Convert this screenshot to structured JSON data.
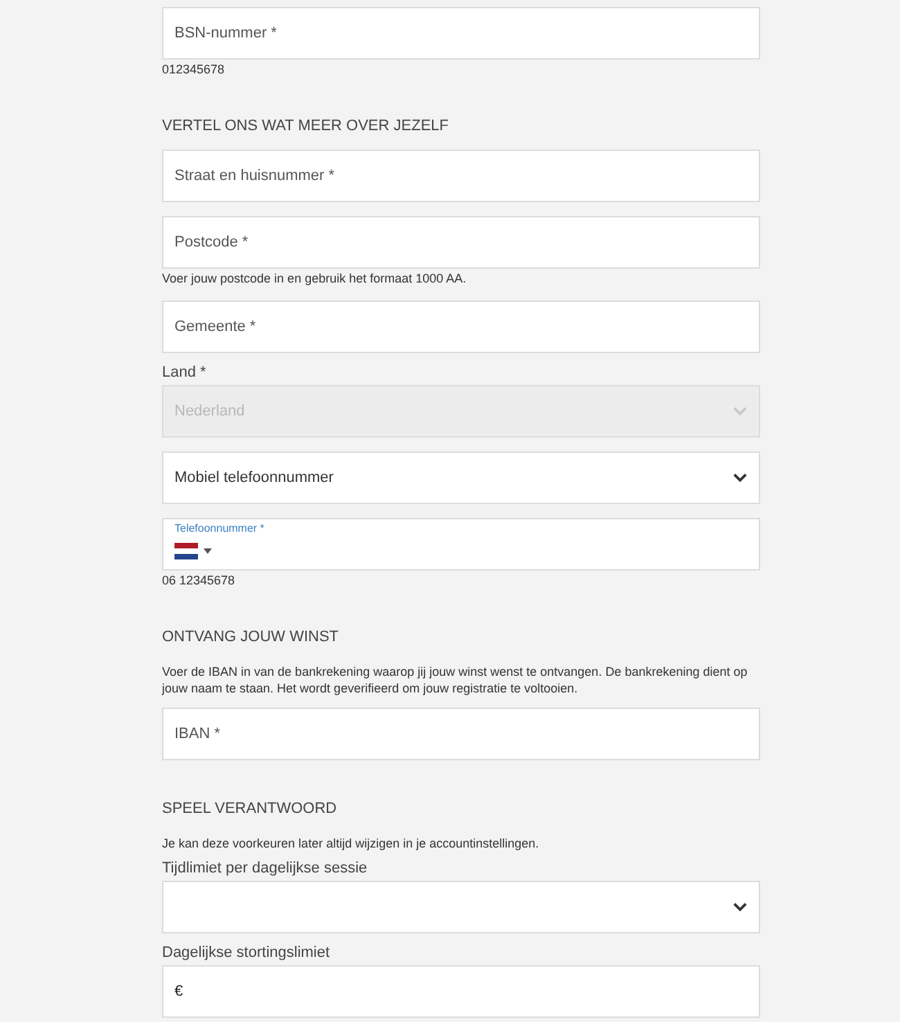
{
  "fields": [
    {
      "kind": "input",
      "placeholder": "BSN-nummer *"
    },
    {
      "kind": "hint",
      "text": "012345678"
    },
    {
      "kind": "heading",
      "text": "VERTEL ONS WAT MEER OVER JEZELF"
    },
    {
      "kind": "input",
      "placeholder": "Straat en huisnummer *"
    },
    {
      "kind": "input",
      "placeholder": "Postcode *"
    },
    {
      "kind": "hint",
      "text": "Voer jouw postcode in en gebruik het formaat 1000 AA."
    },
    {
      "kind": "input",
      "placeholder": "Gemeente *"
    },
    {
      "kind": "label",
      "text": "Land *"
    },
    {
      "kind": "select",
      "value": "Nederland",
      "disabled": true
    },
    {
      "kind": "select",
      "value": "Mobiel telefoonnummer",
      "disabled": false
    },
    {
      "kind": "phone",
      "label": "Telefoonnummer *"
    },
    {
      "kind": "hint",
      "text": "06 12345678"
    },
    {
      "kind": "heading",
      "text": "ONTVANG JOUW WINST"
    },
    {
      "kind": "paragraph",
      "text": "Voer de IBAN in van de bankrekening waarop jij jouw winst wenst te ontvangen. De bankrekening dient op jouw naam te staan. Het wordt geverifieerd om jouw registratie te voltooien."
    },
    {
      "kind": "input",
      "placeholder": "IBAN *"
    },
    {
      "kind": "heading",
      "text": "SPEEL VERANTWOORD"
    },
    {
      "kind": "paragraph",
      "text": "Je kan deze voorkeuren later altijd wijzigen in je accountinstellingen."
    },
    {
      "kind": "label",
      "text": "Tijdlimiet per dagelijkse sessie"
    },
    {
      "kind": "select",
      "disabled": false
    },
    {
      "kind": "label",
      "text": "Dagelijkse stortingslimiet"
    },
    {
      "kind": "prefixed",
      "prefix": "€"
    }
  ]
}
